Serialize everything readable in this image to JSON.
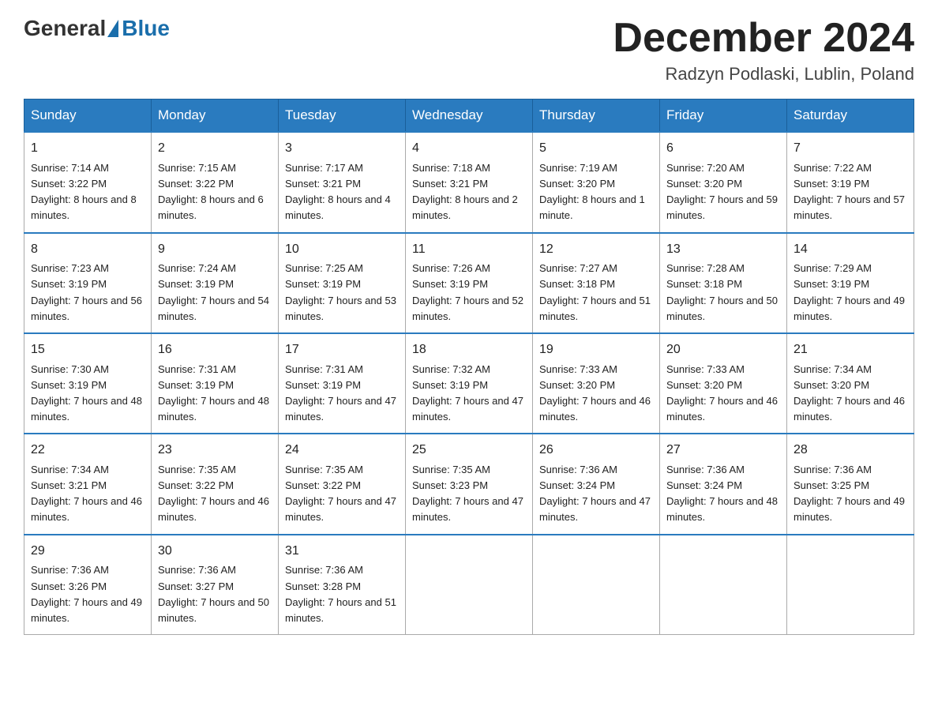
{
  "header": {
    "logo_general": "General",
    "logo_blue": "Blue",
    "month_title": "December 2024",
    "location": "Radzyn Podlaski, Lublin, Poland"
  },
  "weekdays": [
    "Sunday",
    "Monday",
    "Tuesday",
    "Wednesday",
    "Thursday",
    "Friday",
    "Saturday"
  ],
  "weeks": [
    [
      {
        "day": "1",
        "sunrise": "Sunrise: 7:14 AM",
        "sunset": "Sunset: 3:22 PM",
        "daylight": "Daylight: 8 hours and 8 minutes."
      },
      {
        "day": "2",
        "sunrise": "Sunrise: 7:15 AM",
        "sunset": "Sunset: 3:22 PM",
        "daylight": "Daylight: 8 hours and 6 minutes."
      },
      {
        "day": "3",
        "sunrise": "Sunrise: 7:17 AM",
        "sunset": "Sunset: 3:21 PM",
        "daylight": "Daylight: 8 hours and 4 minutes."
      },
      {
        "day": "4",
        "sunrise": "Sunrise: 7:18 AM",
        "sunset": "Sunset: 3:21 PM",
        "daylight": "Daylight: 8 hours and 2 minutes."
      },
      {
        "day": "5",
        "sunrise": "Sunrise: 7:19 AM",
        "sunset": "Sunset: 3:20 PM",
        "daylight": "Daylight: 8 hours and 1 minute."
      },
      {
        "day": "6",
        "sunrise": "Sunrise: 7:20 AM",
        "sunset": "Sunset: 3:20 PM",
        "daylight": "Daylight: 7 hours and 59 minutes."
      },
      {
        "day": "7",
        "sunrise": "Sunrise: 7:22 AM",
        "sunset": "Sunset: 3:19 PM",
        "daylight": "Daylight: 7 hours and 57 minutes."
      }
    ],
    [
      {
        "day": "8",
        "sunrise": "Sunrise: 7:23 AM",
        "sunset": "Sunset: 3:19 PM",
        "daylight": "Daylight: 7 hours and 56 minutes."
      },
      {
        "day": "9",
        "sunrise": "Sunrise: 7:24 AM",
        "sunset": "Sunset: 3:19 PM",
        "daylight": "Daylight: 7 hours and 54 minutes."
      },
      {
        "day": "10",
        "sunrise": "Sunrise: 7:25 AM",
        "sunset": "Sunset: 3:19 PM",
        "daylight": "Daylight: 7 hours and 53 minutes."
      },
      {
        "day": "11",
        "sunrise": "Sunrise: 7:26 AM",
        "sunset": "Sunset: 3:19 PM",
        "daylight": "Daylight: 7 hours and 52 minutes."
      },
      {
        "day": "12",
        "sunrise": "Sunrise: 7:27 AM",
        "sunset": "Sunset: 3:18 PM",
        "daylight": "Daylight: 7 hours and 51 minutes."
      },
      {
        "day": "13",
        "sunrise": "Sunrise: 7:28 AM",
        "sunset": "Sunset: 3:18 PM",
        "daylight": "Daylight: 7 hours and 50 minutes."
      },
      {
        "day": "14",
        "sunrise": "Sunrise: 7:29 AM",
        "sunset": "Sunset: 3:19 PM",
        "daylight": "Daylight: 7 hours and 49 minutes."
      }
    ],
    [
      {
        "day": "15",
        "sunrise": "Sunrise: 7:30 AM",
        "sunset": "Sunset: 3:19 PM",
        "daylight": "Daylight: 7 hours and 48 minutes."
      },
      {
        "day": "16",
        "sunrise": "Sunrise: 7:31 AM",
        "sunset": "Sunset: 3:19 PM",
        "daylight": "Daylight: 7 hours and 48 minutes."
      },
      {
        "day": "17",
        "sunrise": "Sunrise: 7:31 AM",
        "sunset": "Sunset: 3:19 PM",
        "daylight": "Daylight: 7 hours and 47 minutes."
      },
      {
        "day": "18",
        "sunrise": "Sunrise: 7:32 AM",
        "sunset": "Sunset: 3:19 PM",
        "daylight": "Daylight: 7 hours and 47 minutes."
      },
      {
        "day": "19",
        "sunrise": "Sunrise: 7:33 AM",
        "sunset": "Sunset: 3:20 PM",
        "daylight": "Daylight: 7 hours and 46 minutes."
      },
      {
        "day": "20",
        "sunrise": "Sunrise: 7:33 AM",
        "sunset": "Sunset: 3:20 PM",
        "daylight": "Daylight: 7 hours and 46 minutes."
      },
      {
        "day": "21",
        "sunrise": "Sunrise: 7:34 AM",
        "sunset": "Sunset: 3:20 PM",
        "daylight": "Daylight: 7 hours and 46 minutes."
      }
    ],
    [
      {
        "day": "22",
        "sunrise": "Sunrise: 7:34 AM",
        "sunset": "Sunset: 3:21 PM",
        "daylight": "Daylight: 7 hours and 46 minutes."
      },
      {
        "day": "23",
        "sunrise": "Sunrise: 7:35 AM",
        "sunset": "Sunset: 3:22 PM",
        "daylight": "Daylight: 7 hours and 46 minutes."
      },
      {
        "day": "24",
        "sunrise": "Sunrise: 7:35 AM",
        "sunset": "Sunset: 3:22 PM",
        "daylight": "Daylight: 7 hours and 47 minutes."
      },
      {
        "day": "25",
        "sunrise": "Sunrise: 7:35 AM",
        "sunset": "Sunset: 3:23 PM",
        "daylight": "Daylight: 7 hours and 47 minutes."
      },
      {
        "day": "26",
        "sunrise": "Sunrise: 7:36 AM",
        "sunset": "Sunset: 3:24 PM",
        "daylight": "Daylight: 7 hours and 47 minutes."
      },
      {
        "day": "27",
        "sunrise": "Sunrise: 7:36 AM",
        "sunset": "Sunset: 3:24 PM",
        "daylight": "Daylight: 7 hours and 48 minutes."
      },
      {
        "day": "28",
        "sunrise": "Sunrise: 7:36 AM",
        "sunset": "Sunset: 3:25 PM",
        "daylight": "Daylight: 7 hours and 49 minutes."
      }
    ],
    [
      {
        "day": "29",
        "sunrise": "Sunrise: 7:36 AM",
        "sunset": "Sunset: 3:26 PM",
        "daylight": "Daylight: 7 hours and 49 minutes."
      },
      {
        "day": "30",
        "sunrise": "Sunrise: 7:36 AM",
        "sunset": "Sunset: 3:27 PM",
        "daylight": "Daylight: 7 hours and 50 minutes."
      },
      {
        "day": "31",
        "sunrise": "Sunrise: 7:36 AM",
        "sunset": "Sunset: 3:28 PM",
        "daylight": "Daylight: 7 hours and 51 minutes."
      },
      null,
      null,
      null,
      null
    ]
  ]
}
